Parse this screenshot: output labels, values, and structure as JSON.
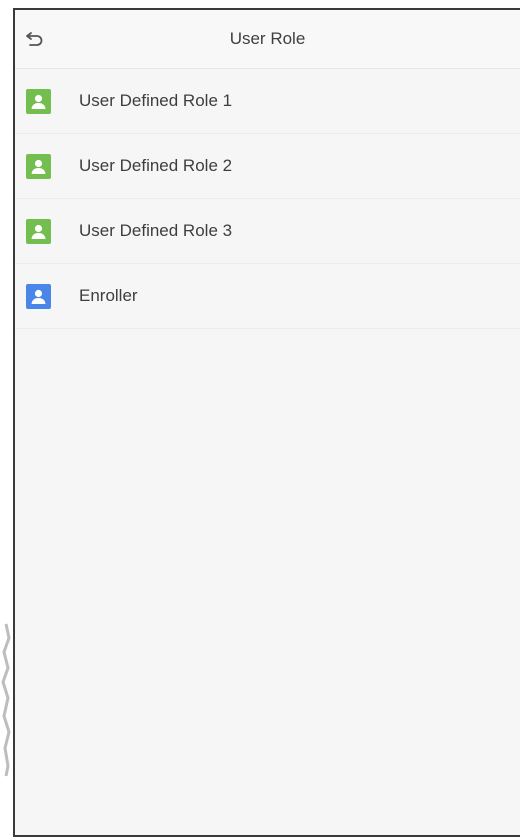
{
  "header": {
    "title": "User Role",
    "back_icon": "back-arrow-icon"
  },
  "roles": [
    {
      "label": "User Defined Role 1",
      "icon": "user-icon",
      "color": "#74bd4f"
    },
    {
      "label": "User Defined Role 2",
      "icon": "user-icon",
      "color": "#74bd4f"
    },
    {
      "label": "User Defined Role 3",
      "icon": "user-icon",
      "color": "#74bd4f"
    },
    {
      "label": "Enroller",
      "icon": "user-icon",
      "color": "#4a86e8"
    }
  ],
  "colors": {
    "background": "#f6f6f6",
    "text": "#3e3e3e",
    "divider": "#ececec"
  }
}
